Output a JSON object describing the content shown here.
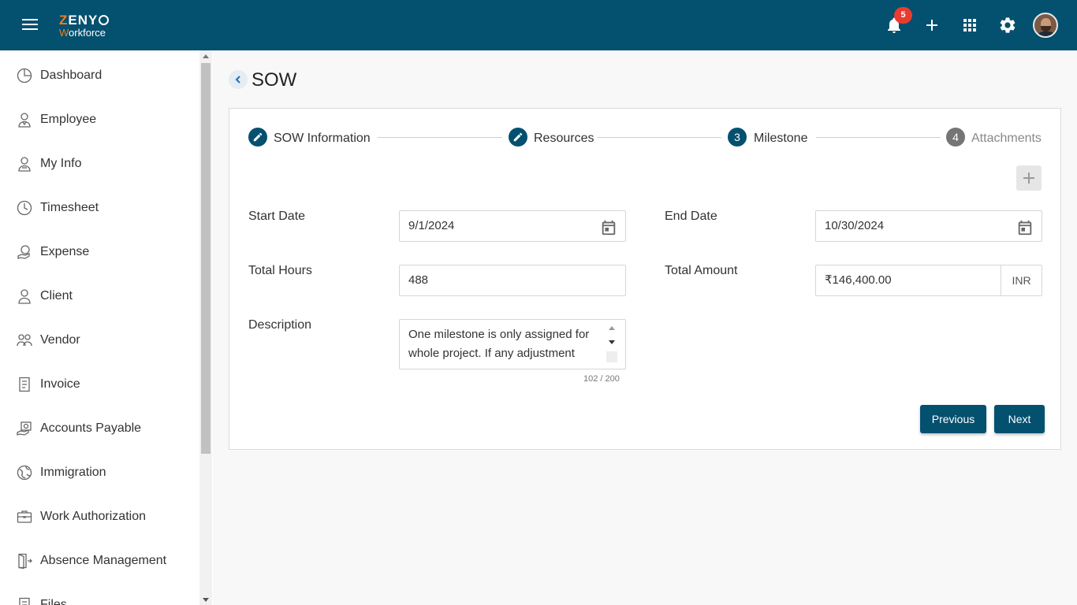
{
  "header": {
    "logo_line1_first": "Z",
    "logo_line1_rest": "ENY",
    "logo_line2_first": "W",
    "logo_line2_rest": "orkforce",
    "notification_count": "5",
    "icons": [
      "menu-icon",
      "bell-icon",
      "plus-icon",
      "apps-grid-icon",
      "gear-icon"
    ]
  },
  "sidebar": {
    "items": [
      {
        "label": "Dashboard",
        "icon": "dashboard-icon"
      },
      {
        "label": "Employee",
        "icon": "employee-icon"
      },
      {
        "label": "My Info",
        "icon": "my-info-icon"
      },
      {
        "label": "Timesheet",
        "icon": "clock-icon"
      },
      {
        "label": "Expense",
        "icon": "expense-icon"
      },
      {
        "label": "Client",
        "icon": "person-icon"
      },
      {
        "label": "Vendor",
        "icon": "vendor-icon"
      },
      {
        "label": "Invoice",
        "icon": "invoice-icon"
      },
      {
        "label": "Accounts Payable",
        "icon": "payable-icon"
      },
      {
        "label": "Immigration",
        "icon": "globe-icon"
      },
      {
        "label": "Work Authorization",
        "icon": "briefcase-icon"
      },
      {
        "label": "Absence Management",
        "icon": "exit-door-icon"
      },
      {
        "label": "Files",
        "icon": "file-icon"
      }
    ]
  },
  "page": {
    "title": "SOW"
  },
  "stepper": {
    "steps": [
      {
        "label": "SOW Information",
        "state": "done",
        "marker": ""
      },
      {
        "label": "Resources",
        "state": "done",
        "marker": ""
      },
      {
        "label": "Milestone",
        "state": "active",
        "marker": "3"
      },
      {
        "label": "Attachments",
        "state": "todo",
        "marker": "4"
      }
    ]
  },
  "form": {
    "start_date_label": "Start Date",
    "start_date_value": "9/1/2024",
    "end_date_label": "End Date",
    "end_date_value": "10/30/2024",
    "total_hours_label": "Total Hours",
    "total_hours_value": "488",
    "total_amount_label": "Total Amount",
    "total_amount_value": "₹146,400.00",
    "currency": "INR",
    "description_label": "Description",
    "description_value": "One milestone is only assigned for whole project. If any adjustment",
    "description_counter": "102 / 200"
  },
  "actions": {
    "previous_label": "Previous",
    "next_label": "Next"
  },
  "colors": {
    "primary": "#04506f",
    "accent": "#f47c20",
    "badge": "#ea3b2e"
  }
}
